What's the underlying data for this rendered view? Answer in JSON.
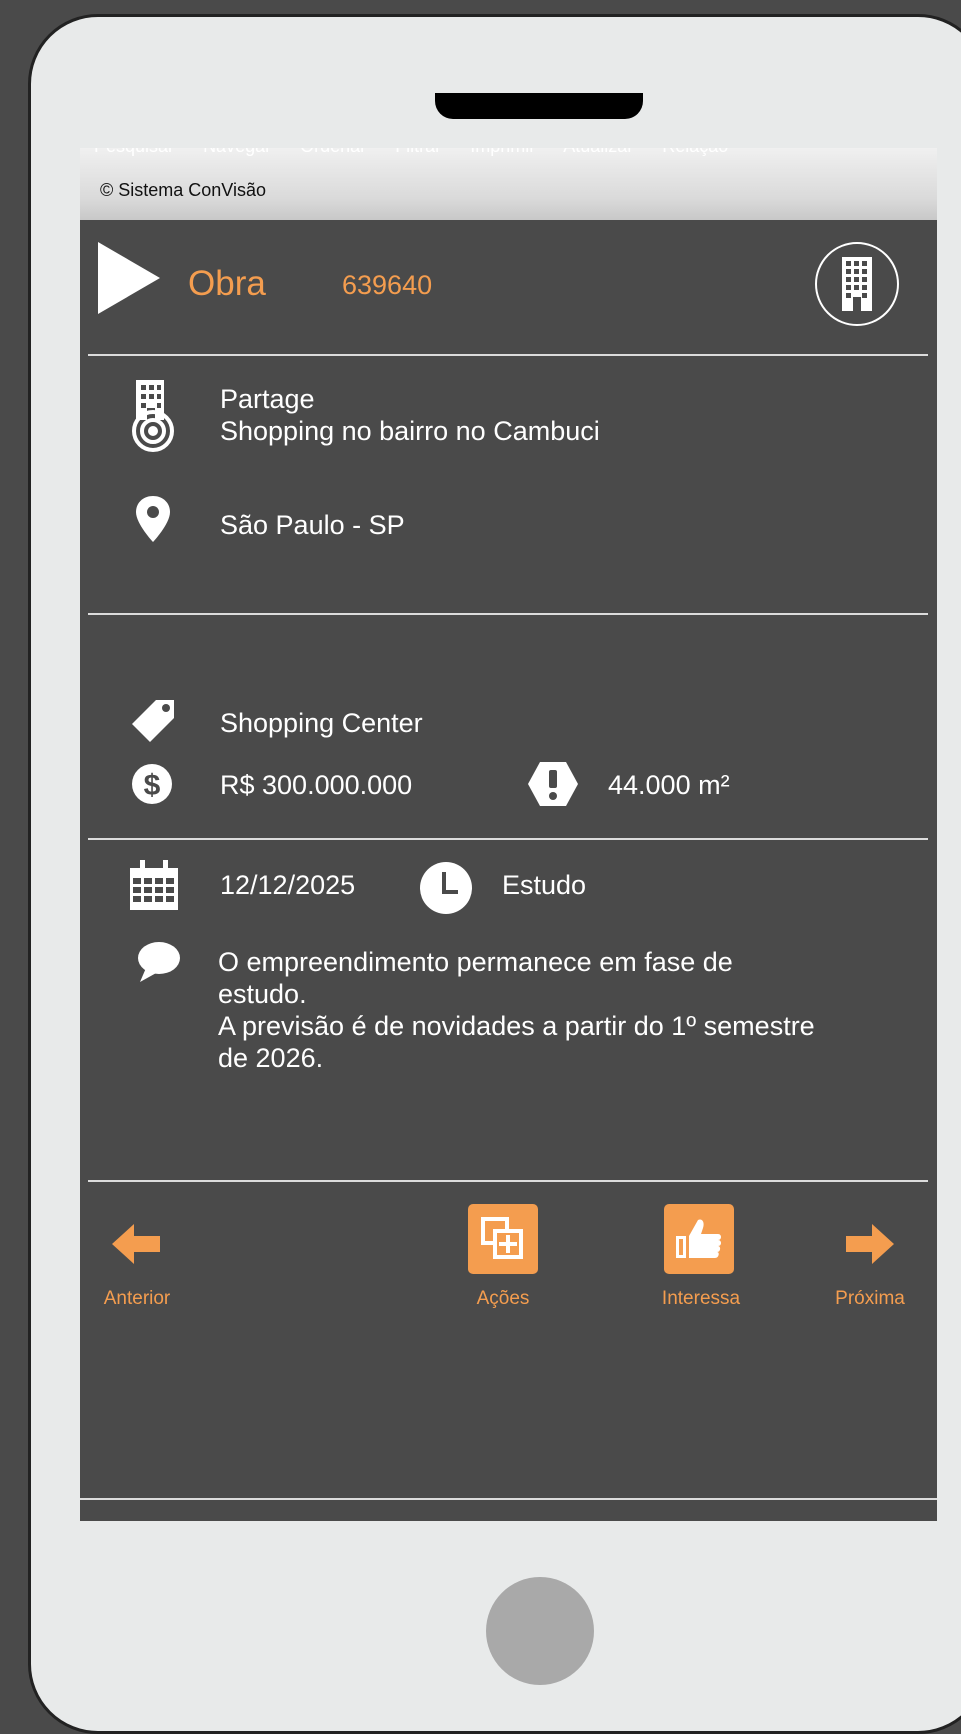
{
  "menu": {
    "items": [
      "Pesquisar",
      "Navegar",
      "Ordenar",
      "Filtrar",
      "Imprimir",
      "Atualizar",
      "Relação"
    ]
  },
  "app": {
    "copyright": "© Sistema ConVisão"
  },
  "header": {
    "title": "Obra",
    "code": "639640"
  },
  "info": {
    "company": "Partage",
    "project": "Shopping no bairro no Cambuci",
    "location": "São Paulo - SP",
    "category": "Shopping Center",
    "value": "R$ 300.000.000",
    "area": "44.000 m²",
    "date": "12/12/2025",
    "phase": "Estudo",
    "comment_line1": "O empreendimento permanece em fase de estudo.",
    "comment_line2": "A previsão é de novidades a partir do 1º semestre de 2026."
  },
  "footer": {
    "prev": "Anterior",
    "actions": "Ações",
    "interest": "Interessa",
    "next": "Próxima"
  },
  "colors": {
    "accent": "#f49d4f",
    "background": "#4a4a4a",
    "bezel": "#e8eaea"
  }
}
